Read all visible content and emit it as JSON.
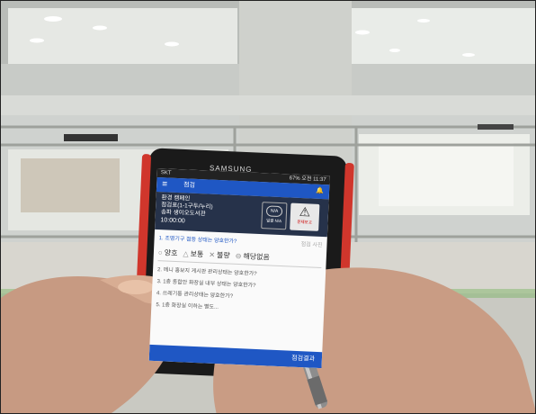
{
  "phone": {
    "brand": "SAMSUNG",
    "status_bar": {
      "carrier": "SKT",
      "battery": "67%",
      "time": "오전 11:37"
    },
    "app_bar": {
      "menu_icon": "menu-icon",
      "title": "점검",
      "bell_icon": "bell-icon"
    },
    "info_panel": {
      "line1": "환경 캠페인",
      "line2": "점검표(1-1구두/누리)",
      "line3": "송파 생이오도서관",
      "time": "10:00:00",
      "na_button": {
        "circle_text": "N/A",
        "label": "일괄 N/A"
      },
      "warn_button": {
        "label": "문제보고"
      }
    },
    "questions": [
      {
        "text": "1. 조명기구 점등 상태는 양호한가?",
        "spec": "점검 사진"
      },
      {
        "text": "2. 메니 홍보지 게시판 관리상태는 양호한가?"
      },
      {
        "text": "3. 1층 종합안 화장실 내부 상태는 양호한가?"
      },
      {
        "text": "4. 쓰레기통 관리상태는 양호한가?"
      },
      {
        "text": "5. 1층 화장실 이하는 별도..."
      }
    ],
    "options": [
      {
        "mark": "○",
        "label": "양호"
      },
      {
        "mark": "△",
        "label": "보통"
      },
      {
        "mark": "✕",
        "label": "불량"
      },
      {
        "mark": "⊖",
        "label": "해당없음"
      }
    ],
    "bottom_button": "점검결과"
  }
}
